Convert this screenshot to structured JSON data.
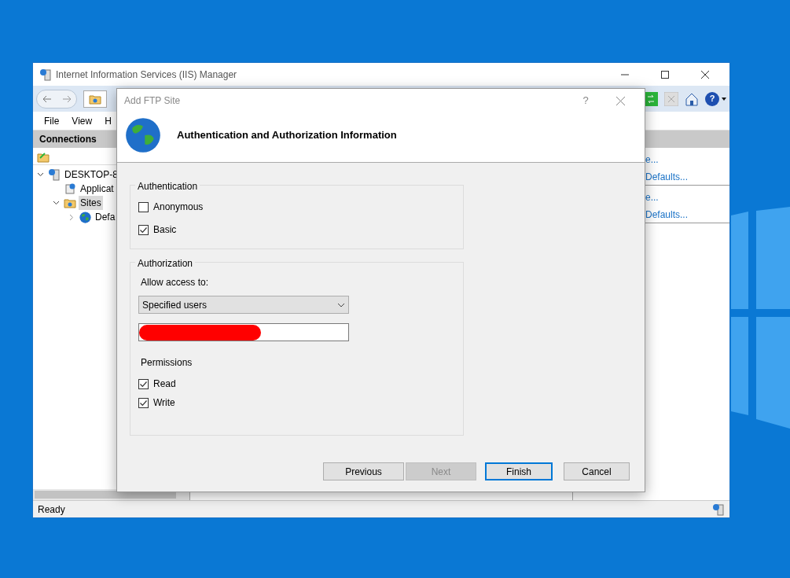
{
  "main_window": {
    "title": "Internet Information Services (IIS) Manager",
    "help_icon": "?",
    "menu": [
      "File",
      "View",
      "H"
    ],
    "connections": {
      "title": "Connections",
      "tree": [
        {
          "label": "DESKTOP-8",
          "kind": "server",
          "expanded": true,
          "selected": false,
          "children": [
            {
              "label": "Applicat",
              "kind": "pools",
              "selected": false
            },
            {
              "label": "Sites",
              "kind": "folder",
              "expanded": true,
              "selected": true,
              "children": [
                {
                  "label": "Defa",
                  "kind": "site",
                  "expanded": false,
                  "selected": false
                }
              ]
            }
          ]
        }
      ]
    },
    "actions": [
      {
        "label": "e..."
      },
      {
        "label": "Defaults..."
      },
      {
        "label": "e..."
      },
      {
        "label": "Defaults..."
      }
    ],
    "status_bar": "Ready"
  },
  "dialog": {
    "title": "Add FTP Site",
    "help_button": "?",
    "heading": "Authentication and Authorization Information",
    "authentication": {
      "title": "Authentication",
      "options": [
        {
          "label": "Anonymous",
          "checked": false
        },
        {
          "label": "Basic",
          "checked": true
        }
      ]
    },
    "authorization": {
      "title": "Authorization",
      "access_label": "Allow access to:",
      "access_value": "Specified users",
      "users_redacted": true,
      "permissions_label": "Permissions",
      "permissions": [
        {
          "label": "Read",
          "checked": true
        },
        {
          "label": "Write",
          "checked": true
        }
      ]
    },
    "buttons": [
      {
        "label": "Previous",
        "disabled": false,
        "default": false
      },
      {
        "label": "Next",
        "disabled": true,
        "default": false
      },
      {
        "label": "Finish",
        "disabled": false,
        "default": true
      },
      {
        "label": "Cancel",
        "disabled": false,
        "default": false
      }
    ]
  }
}
